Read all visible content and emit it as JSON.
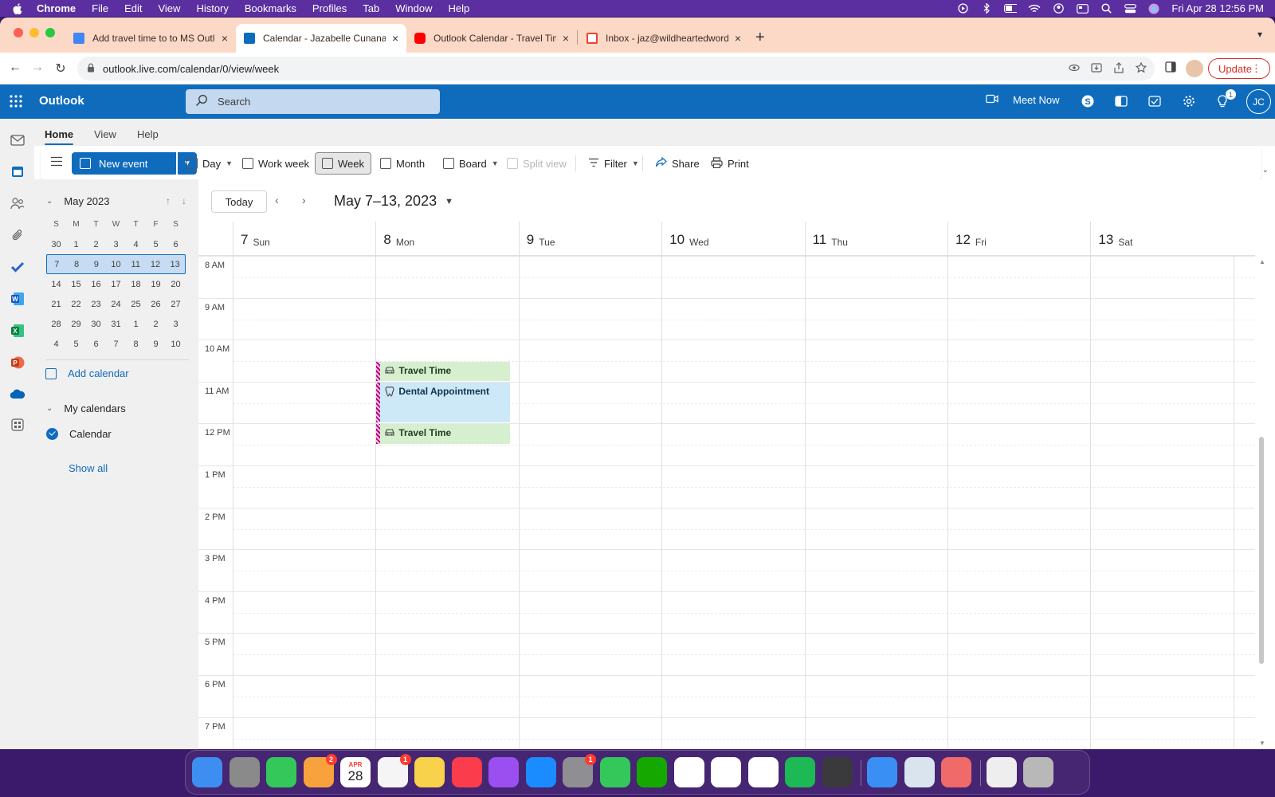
{
  "menubar": {
    "app": "Chrome",
    "items": [
      "File",
      "Edit",
      "View",
      "History",
      "Bookmarks",
      "Profiles",
      "Tab",
      "Window",
      "Help"
    ],
    "clock": "Fri Apr 28  12:56 PM"
  },
  "tabs": [
    {
      "label": "Add travel time to to MS Outlook",
      "icon": "google-docs-icon",
      "color": "#4285f4"
    },
    {
      "label": "Calendar - Jazabelle Cunanan",
      "icon": "outlook-calendar-icon",
      "color": "#0f6cbd"
    },
    {
      "label": "Outlook Calendar - Travel Time",
      "icon": "youtube-icon",
      "color": "#ff0000"
    },
    {
      "label": "Inbox - jaz@wildheartedwords.",
      "icon": "gmail-icon",
      "color": "#ea4335"
    }
  ],
  "address": {
    "url": "outlook.live.com/calendar/0/view/week",
    "update_label": "Update"
  },
  "outlook": {
    "brand": "Outlook",
    "search_placeholder": "Search",
    "meet_now": "Meet Now",
    "tips_badge": "1",
    "avatar_initials": "JC",
    "accent": "#0f6cbd"
  },
  "ribbon": {
    "tabs": [
      "Home",
      "View",
      "Help"
    ],
    "new_event": "New event",
    "day": "Day",
    "work_week": "Work week",
    "week": "Week",
    "month": "Month",
    "board": "Board",
    "split_view": "Split view",
    "filter": "Filter",
    "share": "Share",
    "print": "Print"
  },
  "minical": {
    "title": "May 2023",
    "weekday_heads": [
      "S",
      "M",
      "T",
      "W",
      "T",
      "F",
      "S"
    ],
    "weeks": [
      [
        "30",
        "1",
        "2",
        "3",
        "4",
        "5",
        "6"
      ],
      [
        "7",
        "8",
        "9",
        "10",
        "11",
        "12",
        "13"
      ],
      [
        "14",
        "15",
        "16",
        "17",
        "18",
        "19",
        "20"
      ],
      [
        "21",
        "22",
        "23",
        "24",
        "25",
        "26",
        "27"
      ],
      [
        "28",
        "29",
        "30",
        "31",
        "1",
        "2",
        "3"
      ],
      [
        "4",
        "5",
        "6",
        "7",
        "8",
        "9",
        "10"
      ]
    ],
    "selected_week_index": 1
  },
  "leftpane": {
    "add_calendar": "Add calendar",
    "my_calendars": "My calendars",
    "calendar_item": "Calendar",
    "show_all": "Show all"
  },
  "calendar": {
    "today": "Today",
    "range_title": "May 7–13, 2023",
    "days": [
      {
        "num": "7",
        "name": "Sun"
      },
      {
        "num": "8",
        "name": "Mon"
      },
      {
        "num": "9",
        "name": "Tue"
      },
      {
        "num": "10",
        "name": "Wed"
      },
      {
        "num": "11",
        "name": "Thu"
      },
      {
        "num": "12",
        "name": "Fri"
      },
      {
        "num": "13",
        "name": "Sat"
      }
    ],
    "hours": [
      "8 AM",
      "9 AM",
      "10 AM",
      "11 AM",
      "12 PM",
      "1 PM",
      "2 PM",
      "3 PM",
      "4 PM",
      "5 PM",
      "6 PM",
      "7 PM"
    ],
    "events": [
      {
        "title": "Travel Time",
        "type": "travel",
        "icon": "car-icon"
      },
      {
        "title": "Dental Appointment",
        "type": "dental",
        "icon": "tooth-icon"
      },
      {
        "title": "Travel Time",
        "type": "travel",
        "icon": "car-icon"
      }
    ]
  },
  "dock": {
    "apps": [
      {
        "name": "finder",
        "color": "#3d8ef0"
      },
      {
        "name": "launchpad",
        "color": "#8a8a8a"
      },
      {
        "name": "messages",
        "color": "#34c759"
      },
      {
        "name": "photos",
        "color": "#f7a23c",
        "badge": "2"
      },
      {
        "name": "calendar",
        "color": "#ffffff",
        "month": "APR",
        "day": "28"
      },
      {
        "name": "reminders",
        "color": "#f5f5f5",
        "badge": "1"
      },
      {
        "name": "notes",
        "color": "#f7d24a"
      },
      {
        "name": "music",
        "color": "#fa3c4c"
      },
      {
        "name": "podcasts",
        "color": "#9b4ff0"
      },
      {
        "name": "app-store",
        "color": "#1a8cff"
      },
      {
        "name": "system-settings",
        "color": "#8e8e93",
        "badge": "1"
      },
      {
        "name": "facetime",
        "color": "#34c759"
      },
      {
        "name": "upwork",
        "color": "#14a800"
      },
      {
        "name": "slack",
        "color": "#ffffff"
      },
      {
        "name": "clickup",
        "color": "#ffffff"
      },
      {
        "name": "chrome",
        "color": "#ffffff"
      },
      {
        "name": "spotify",
        "color": "#1db954"
      },
      {
        "name": "calculator",
        "color": "#3a3a3c"
      },
      {
        "name": "mail",
        "color": "#3a8ff5"
      },
      {
        "name": "preview",
        "color": "#d9e4ef"
      },
      {
        "name": "asana",
        "color": "#f06a6a"
      },
      {
        "name": "document",
        "color": "#eeeeee"
      },
      {
        "name": "trash",
        "color": "#b8b8b8"
      }
    ]
  }
}
